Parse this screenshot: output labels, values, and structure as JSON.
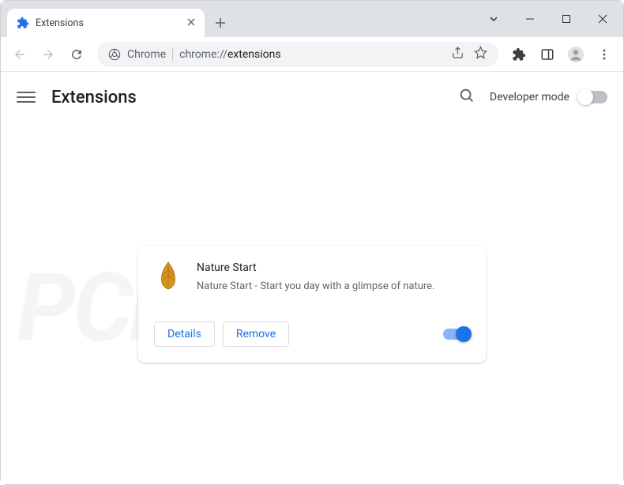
{
  "tab": {
    "title": "Extensions"
  },
  "omnibox": {
    "chip_label": "Chrome",
    "url_proto": "chrome://",
    "url_path": "extensions"
  },
  "header": {
    "title": "Extensions",
    "dev_mode_label": "Developer mode"
  },
  "extension": {
    "name": "Nature Start",
    "description": "Nature Start - Start you day with a glimpse of nature.",
    "details_label": "Details",
    "remove_label": "Remove",
    "enabled": true
  },
  "watermark": "PCrisk.com"
}
